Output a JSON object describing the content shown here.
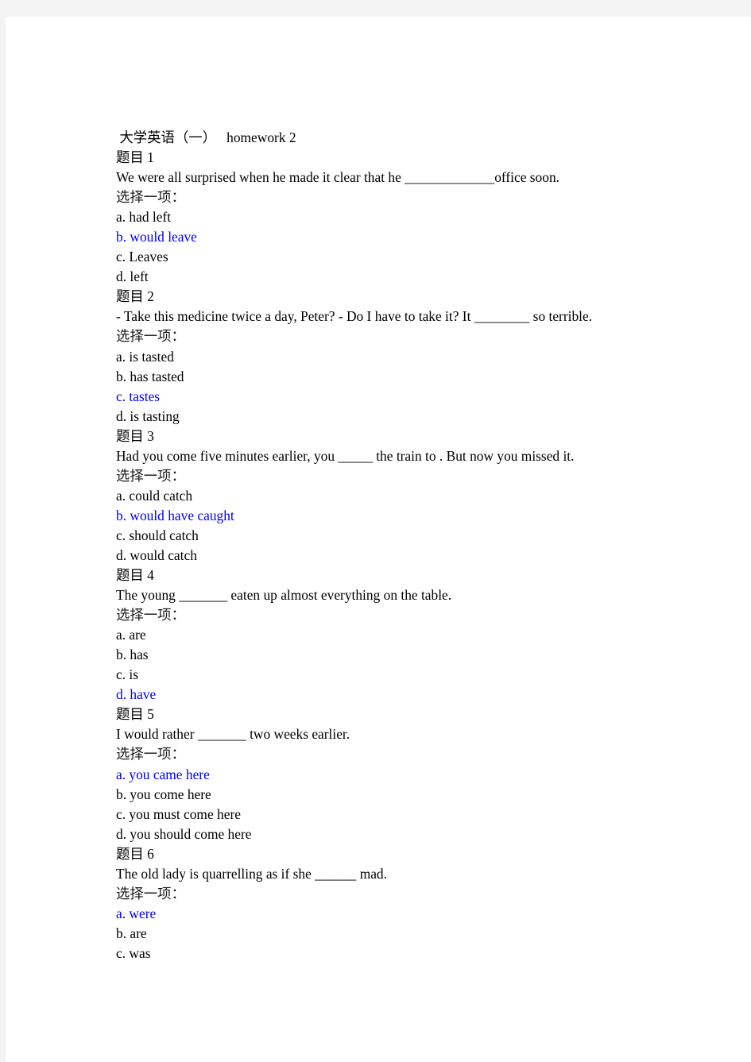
{
  "document": {
    "title": " 大学英语（一）   homework 2",
    "select_hint": "选择一项：",
    "correct_color": "#0000ff",
    "text_color": "#000000",
    "page_background": "#ffffff",
    "band_background": "#f3f3f3"
  },
  "questions": [
    {
      "label": "题目 1",
      "prompt": "We were all surprised when he made it clear that he _____________office soon.",
      "select_hint": "选择一项：",
      "options": [
        {
          "text": "a. had left",
          "correct": false
        },
        {
          "text": "b. would leave",
          "correct": true
        },
        {
          "text": "c. Leaves",
          "correct": false
        },
        {
          "text": "d. left",
          "correct": false
        }
      ]
    },
    {
      "label": "题目 2",
      "prompt": "- Take this medicine twice a day, Peter? - Do I have to take it? It ________ so terrible.",
      "select_hint": "选择一项：",
      "options": [
        {
          "text": "a. is tasted",
          "correct": false
        },
        {
          "text": "b. has tasted",
          "correct": false
        },
        {
          "text": "c. tastes",
          "correct": true
        },
        {
          "text": "d. is tasting",
          "correct": false
        }
      ]
    },
    {
      "label": "题目 3",
      "prompt": "Had you come five minutes earlier, you _____ the train to . But now you missed it.",
      "select_hint": "选择一项：",
      "options": [
        {
          "text": "a. could catch",
          "correct": false
        },
        {
          "text": "b. would have caught",
          "correct": true
        },
        {
          "text": "c. should catch",
          "correct": false
        },
        {
          "text": "d. would catch",
          "correct": false
        }
      ]
    },
    {
      "label": "题目 4",
      "prompt": "The young _______ eaten up almost everything on the table.",
      "select_hint": "选择一项：",
      "options": [
        {
          "text": "a. are",
          "correct": false
        },
        {
          "text": "b. has",
          "correct": false
        },
        {
          "text": "c. is",
          "correct": false
        },
        {
          "text": "d. have",
          "correct": true
        }
      ]
    },
    {
      "label": "题目 5",
      "prompt": "I would rather _______ two weeks earlier.",
      "select_hint": "选择一项：",
      "options": [
        {
          "text": "a. you came here",
          "correct": true
        },
        {
          "text": "b. you come here",
          "correct": false
        },
        {
          "text": "c. you must come here",
          "correct": false
        },
        {
          "text": "d. you should come here",
          "correct": false
        }
      ]
    },
    {
      "label": "题目 6",
      "prompt": "The old lady is quarrelling as if she ______ mad.",
      "select_hint": "选择一项：",
      "options": [
        {
          "text": "a. were",
          "correct": true
        },
        {
          "text": "b. are",
          "correct": false
        },
        {
          "text": "c. was",
          "correct": false
        }
      ]
    }
  ]
}
